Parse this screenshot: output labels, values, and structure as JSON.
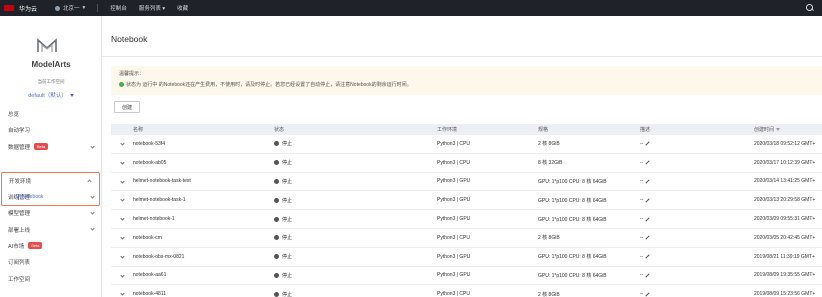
{
  "topbar": {
    "brand": "华为云",
    "region": "北京一",
    "links": [
      "控制台",
      "服务列表 ▾",
      "收藏"
    ]
  },
  "sidebar": {
    "product": "ModelArts",
    "workspace_label": "当前工作空间",
    "workspace_value": "default（默认）",
    "items": [
      {
        "label": "总览",
        "badge": "",
        "chevron": false
      },
      {
        "label": "自动学习",
        "badge": "",
        "chevron": false
      },
      {
        "label": "数据管理",
        "badge": "Beta",
        "chevron": true
      },
      {
        "label": "开发环境",
        "badge": "",
        "chevron": true
      },
      {
        "label": "训练管理",
        "badge": "",
        "chevron": true
      },
      {
        "label": "模型管理",
        "badge": "",
        "chevron": true
      },
      {
        "label": "部署上线",
        "badge": "",
        "chevron": true
      },
      {
        "label": "AI市场",
        "badge": "Beta",
        "chevron": false
      },
      {
        "label": "订阅列表",
        "badge": "",
        "chevron": false
      },
      {
        "label": "工作空间",
        "badge": "",
        "chevron": false
      }
    ],
    "sub_item": "Notebook"
  },
  "main": {
    "title": "Notebook",
    "notice_title": "温馨提示：",
    "notice_text": "状态为 运行中 的Notebook还在产生费用，不使用时，请及时停止。若您已经设置了自动停止，请注意Notebook的剩余运行时间。",
    "create_button": "创建",
    "columns": [
      "名称",
      "状态",
      "工作环境",
      "规格",
      "描述",
      "创建时间"
    ],
    "rows": [
      {
        "name": "notebook-53f4",
        "status": "停止",
        "env": "Python3 | CPU",
        "spec": "2 核 8GiB",
        "desc": "--",
        "time": "2020/03/18 09:52:12 GMT+"
      },
      {
        "name": "notebook-ab05",
        "status": "停止",
        "env": "Python3 | CPU",
        "spec": "8 核 32GiB",
        "desc": "--",
        "time": "2020/03/17 10:12:39 GMT+"
      },
      {
        "name": "helmet-notebook-task-test",
        "status": "停止",
        "env": "Python3 | GPU",
        "spec": "GPU: 1*p100 CPU: 8 核 64GiB",
        "desc": "--",
        "time": "2020/03/14 13:41:25 GMT+"
      },
      {
        "name": "helmet-notebook-task-1",
        "status": "停止",
        "env": "Python3 | GPU",
        "spec": "GPU: 1*p100 CPU: 8 核 64GiB",
        "desc": "--",
        "time": "2020/03/13 20:29:58 GMT+"
      },
      {
        "name": "helmet-notebook-1",
        "status": "停止",
        "env": "Python3 | GPU",
        "spec": "GPU: 1*p100 CPU: 8 核 64GiB",
        "desc": "--",
        "time": "2020/03/09 09:55:31 GMT+"
      },
      {
        "name": "notebook-cm",
        "status": "停止",
        "env": "Python3 | CPU",
        "spec": "2 核 8GiB",
        "desc": "--",
        "time": "2020/03/05 20:42:45 GMT+"
      },
      {
        "name": "notebook-obs-mx-0821",
        "status": "停止",
        "env": "Python3 | GPU",
        "spec": "GPU: 1*p100 CPU: 8 核 64GiB",
        "desc": "--",
        "time": "2019/08/21 11:39:19 GMT+"
      },
      {
        "name": "notebook-aa61",
        "status": "停止",
        "env": "Python3 | GPU",
        "spec": "GPU: 1*p100 CPU: 8 核 64GiB",
        "desc": "--",
        "time": "2019/08/09 19:35:55 GMT+"
      },
      {
        "name": "notebook-4811",
        "status": "停止",
        "env": "Python3 | CPU",
        "spec": "2 核 8GiB",
        "desc": "--",
        "time": "2019/08/09 15:23:56 GMT+"
      }
    ]
  }
}
